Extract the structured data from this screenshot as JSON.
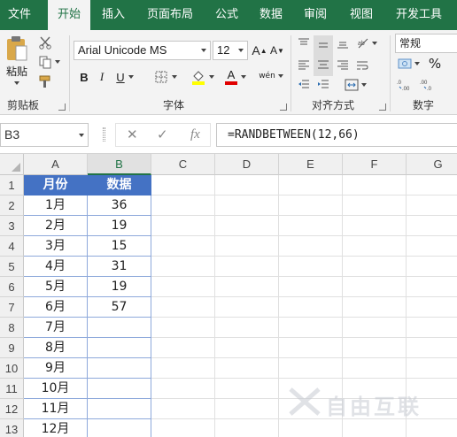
{
  "tabs": [
    "文件",
    "开始",
    "插入",
    "页面布局",
    "公式",
    "数据",
    "审阅",
    "视图",
    "开发工具"
  ],
  "active_tab": "开始",
  "accent_color": "#217346",
  "ribbon": {
    "clipboard": {
      "paste_label": "粘贴",
      "group_label": "剪贴板"
    },
    "font": {
      "font_name": "Arial Unicode MS",
      "font_size": "12",
      "grow_label": "A",
      "shrink_label": "A",
      "bold_label": "B",
      "italic_label": "I",
      "underline_label": "U",
      "font_color_label": "A",
      "phonetic_label": "wén",
      "group_label": "字体"
    },
    "alignment": {
      "group_label": "对齐方式"
    },
    "number": {
      "format": "常规",
      "percent_label": "%",
      "group_label": "数字"
    }
  },
  "formula_bar": {
    "name_box": "B3",
    "formula": "=RANDBETWEEN(12,66)",
    "fx_label": "fx",
    "cancel_label": "✕",
    "enter_label": "✓"
  },
  "sheet": {
    "columns": [
      "A",
      "B",
      "C",
      "D",
      "E",
      "F",
      "G"
    ],
    "selected_column": "B",
    "rows": [
      "1",
      "2",
      "3",
      "4",
      "5",
      "6",
      "7",
      "8",
      "9",
      "10",
      "11",
      "12",
      "13"
    ],
    "table": {
      "headers": [
        "月份",
        "数据"
      ],
      "months": [
        "1月",
        "2月",
        "3月",
        "4月",
        "5月",
        "6月",
        "7月",
        "8月",
        "9月",
        "10月",
        "11月",
        "12月"
      ],
      "values": [
        "36",
        "19",
        "15",
        "31",
        "19",
        "57",
        "",
        "",
        "",
        "",
        "",
        ""
      ]
    }
  },
  "watermark_text": "自由互联"
}
